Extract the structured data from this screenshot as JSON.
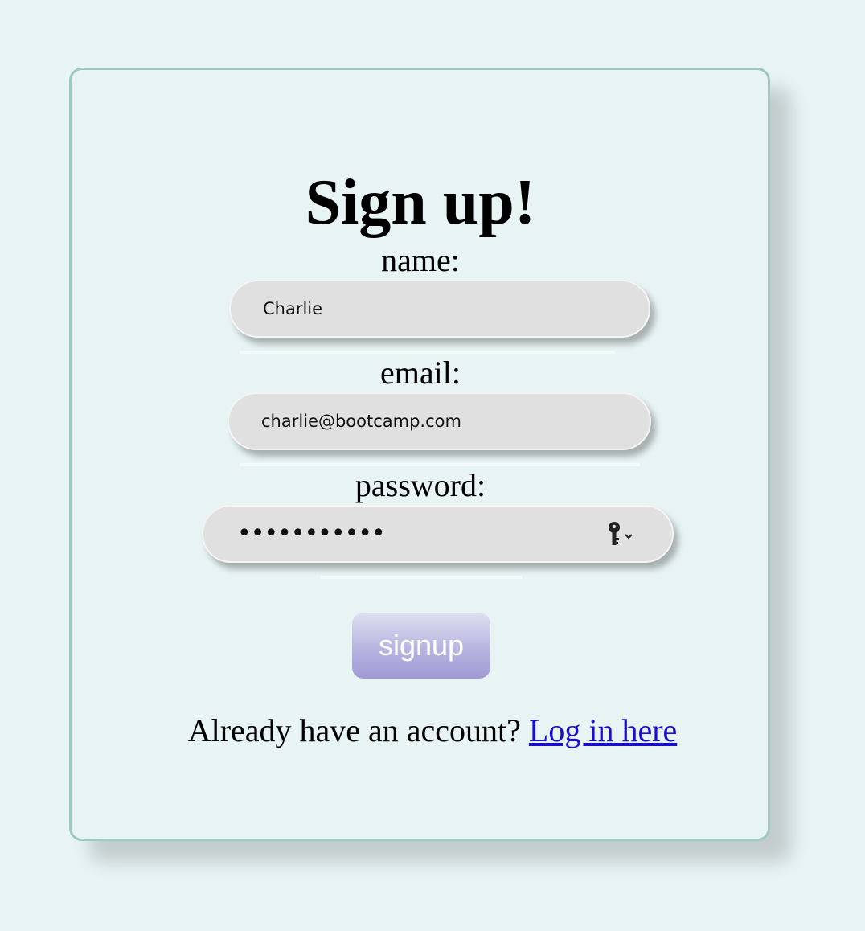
{
  "form": {
    "title": "Sign up!",
    "name_label": "name:",
    "name_value": "Charlie",
    "email_label": "email:",
    "email_value": "charlie@bootcamp.com",
    "password_label": "password:",
    "password_mask": "•••••••••••",
    "submit_label": "signup"
  },
  "footer": {
    "prompt": "Already have an account?",
    "login_link": "Log in here"
  },
  "icons": {
    "password_manager": "key-icon",
    "password_manager_menu": "chevron-down-icon"
  },
  "colors": {
    "background": "#e7f4f3",
    "card_border": "#9fc9c0",
    "input_fill": "#e0e0e0",
    "button_gradient_top": "#dedff0",
    "button_gradient_bottom": "#9f98d4",
    "link": "#1a0dcc"
  }
}
